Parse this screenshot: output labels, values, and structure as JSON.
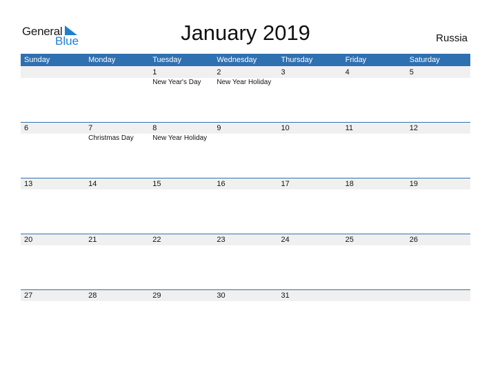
{
  "logo": {
    "text_general": "General",
    "text_blue": "Blue",
    "accent": "#1f7fd0"
  },
  "title": "January 2019",
  "country": "Russia",
  "colors": {
    "header_bg": "#2f70b1",
    "row_band": "#f0f0f0"
  },
  "weekdays": [
    "Sunday",
    "Monday",
    "Tuesday",
    "Wednesday",
    "Thursday",
    "Friday",
    "Saturday"
  ],
  "weeks": [
    {
      "days": [
        {
          "num": "",
          "holiday": ""
        },
        {
          "num": "",
          "holiday": ""
        },
        {
          "num": "1",
          "holiday": "New Year's Day"
        },
        {
          "num": "2",
          "holiday": "New Year Holiday"
        },
        {
          "num": "3",
          "holiday": ""
        },
        {
          "num": "4",
          "holiday": ""
        },
        {
          "num": "5",
          "holiday": ""
        }
      ]
    },
    {
      "days": [
        {
          "num": "6",
          "holiday": ""
        },
        {
          "num": "7",
          "holiday": "Christmas Day"
        },
        {
          "num": "8",
          "holiday": "New Year Holiday"
        },
        {
          "num": "9",
          "holiday": ""
        },
        {
          "num": "10",
          "holiday": ""
        },
        {
          "num": "11",
          "holiday": ""
        },
        {
          "num": "12",
          "holiday": ""
        }
      ]
    },
    {
      "days": [
        {
          "num": "13",
          "holiday": ""
        },
        {
          "num": "14",
          "holiday": ""
        },
        {
          "num": "15",
          "holiday": ""
        },
        {
          "num": "16",
          "holiday": ""
        },
        {
          "num": "17",
          "holiday": ""
        },
        {
          "num": "18",
          "holiday": ""
        },
        {
          "num": "19",
          "holiday": ""
        }
      ]
    },
    {
      "days": [
        {
          "num": "20",
          "holiday": ""
        },
        {
          "num": "21",
          "holiday": ""
        },
        {
          "num": "22",
          "holiday": ""
        },
        {
          "num": "23",
          "holiday": ""
        },
        {
          "num": "24",
          "holiday": ""
        },
        {
          "num": "25",
          "holiday": ""
        },
        {
          "num": "26",
          "holiday": ""
        }
      ]
    },
    {
      "days": [
        {
          "num": "27",
          "holiday": ""
        },
        {
          "num": "28",
          "holiday": ""
        },
        {
          "num": "29",
          "holiday": ""
        },
        {
          "num": "30",
          "holiday": ""
        },
        {
          "num": "31",
          "holiday": ""
        },
        {
          "num": "",
          "holiday": ""
        },
        {
          "num": "",
          "holiday": ""
        }
      ]
    }
  ]
}
